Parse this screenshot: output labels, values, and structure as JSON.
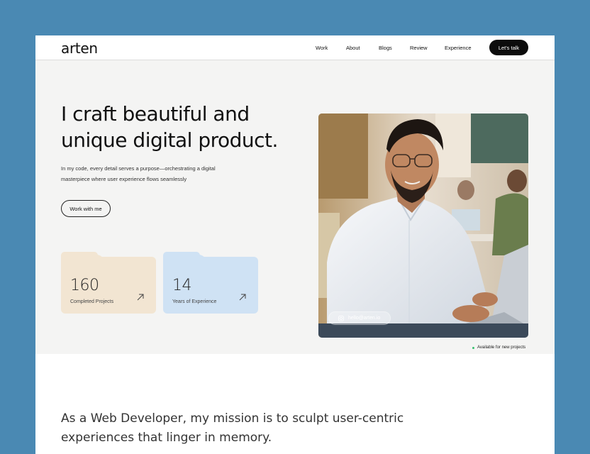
{
  "brand": {
    "logo": "arten"
  },
  "nav": {
    "links": [
      "Work",
      "About",
      "Blogs",
      "Review",
      "Experience"
    ],
    "cta": "Let's talk"
  },
  "hero": {
    "headline_line1": "I craft beautiful and",
    "headline_line2": "unique digital product.",
    "subtitle": "In my code, every detail serves a purpose—orchestrating a digital masterpiece where user experience flows seamlessly",
    "button": "Work with me",
    "stats": [
      {
        "value": "160",
        "label": "Completed Projects",
        "color": "#f2e5d2"
      },
      {
        "value": "14",
        "label": "Years of Experience",
        "color": "#cfe2f4"
      }
    ],
    "email": "hello@arten.io",
    "availability": "Available for new projects"
  },
  "mission": {
    "line1": "As a Web Developer, my mission is to sculpt user-centric",
    "line2": "experiences that linger in memory."
  },
  "colors": {
    "background": "#4a89b3",
    "hero_bg": "#f4f4f3",
    "cta": "#0c0c0c",
    "status": "#39c06f"
  }
}
